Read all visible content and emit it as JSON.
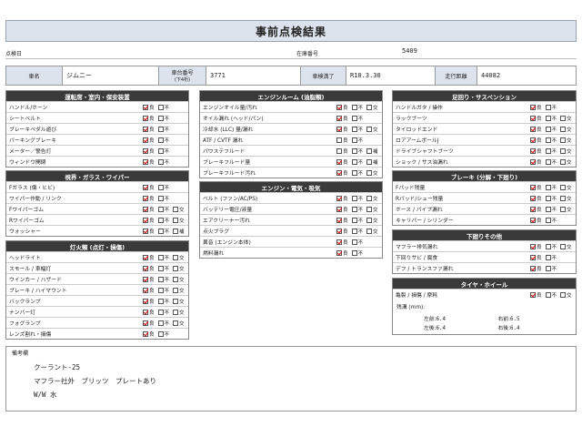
{
  "title": "事前点検結果",
  "header": {
    "check_date_label": "点検日",
    "stock_label": "在庫番号",
    "stock_no": "5409",
    "model_label": "車名",
    "model": "ジムニー",
    "chassis_label": "車台番号",
    "chassis_sub": "(下4桁)",
    "chassis": "3771",
    "inspection_label": "車検満了",
    "inspection": "R10.3.30",
    "mileage_label": "走行距離",
    "mileage": "44082"
  },
  "opt_labels": {
    "good": "良",
    "bad": "不",
    "exchange": "交",
    "fill": "補"
  },
  "sections": {
    "interior": {
      "title": "運転席・室内・保安装置",
      "items": [
        {
          "name": "ハンドル/ホーン",
          "opts": [
            "good",
            "bad"
          ],
          "checked": "good"
        },
        {
          "name": "シートベルト",
          "opts": [
            "good",
            "bad"
          ],
          "checked": "good"
        },
        {
          "name": "ブレーキペダル遊び",
          "opts": [
            "good",
            "bad"
          ],
          "checked": "good"
        },
        {
          "name": "パーキングブレーキ",
          "opts": [
            "good",
            "bad"
          ],
          "checked": "good"
        },
        {
          "name": "メーター／警告灯",
          "opts": [
            "good",
            "bad"
          ],
          "checked": "good"
        },
        {
          "name": "ウィンドウ開閉",
          "opts": [
            "good",
            "bad"
          ],
          "checked": "good"
        }
      ]
    },
    "visibility": {
      "title": "視界・ガラス・ワイパー",
      "items": [
        {
          "name": "Fガラス (傷・ヒビ)",
          "opts": [
            "good",
            "bad"
          ],
          "checked": "good"
        },
        {
          "name": "ワイパー作動 / リンク",
          "opts": [
            "good",
            "bad"
          ],
          "checked": "good"
        },
        {
          "name": "Fワイパーゴム",
          "opts": [
            "good",
            "bad",
            "exchange"
          ],
          "checked": "good"
        },
        {
          "name": "Rワイパーゴム",
          "opts": [
            "good",
            "bad",
            "exchange"
          ],
          "checked": "good"
        },
        {
          "name": "ウォッシャー",
          "opts": [
            "good",
            "bad",
            "fill"
          ],
          "checked": "good"
        }
      ]
    },
    "lights": {
      "title": "灯火類 (点灯・損傷)",
      "items": [
        {
          "name": "ヘッドライト",
          "opts": [
            "good",
            "bad",
            "exchange"
          ],
          "checked": "good"
        },
        {
          "name": "スモール / 車幅灯",
          "opts": [
            "good",
            "bad",
            "exchange"
          ],
          "checked": "good"
        },
        {
          "name": "ウインカー / ハザード",
          "opts": [
            "good",
            "bad",
            "exchange"
          ],
          "checked": "good"
        },
        {
          "name": "ブレーキ / ハイマウント",
          "opts": [
            "good",
            "bad",
            "exchange"
          ],
          "checked": "good"
        },
        {
          "name": "バックランプ",
          "opts": [
            "good",
            "bad",
            "exchange"
          ],
          "checked": "good"
        },
        {
          "name": "ナンバー灯",
          "opts": [
            "good",
            "bad",
            "exchange"
          ],
          "checked": "good"
        },
        {
          "name": "フォグランプ",
          "opts": [
            "good",
            "bad",
            "exchange"
          ],
          "checked": "good"
        },
        {
          "name": "レンズ割れ・損傷",
          "opts": [
            "good",
            "bad"
          ],
          "checked": "good"
        }
      ]
    },
    "engine": {
      "title": "エンジンルーム (油脂類)",
      "items": [
        {
          "name": "エンジンオイル量/汚れ",
          "opts": [
            "good",
            "bad",
            "exchange"
          ],
          "checked": "good"
        },
        {
          "name": "オイル漏れ (ヘッド/パン)",
          "opts": [
            "good",
            "bad"
          ],
          "checked": "good"
        },
        {
          "name": "冷却水 (LLC) 量/漏れ",
          "opts": [
            "good",
            "bad",
            "exchange"
          ],
          "checked": "good"
        },
        {
          "name": "ATF / CVTF 漏れ",
          "opts": [
            "good",
            "bad"
          ],
          "checked": ""
        },
        {
          "name": "パワステフルード",
          "opts": [
            "good",
            "bad",
            "fill"
          ],
          "checked": ""
        },
        {
          "name": "ブレーキフルード量",
          "opts": [
            "good",
            "bad",
            "fill"
          ],
          "checked": "good"
        },
        {
          "name": "ブレーキフルード汚れ",
          "opts": [
            "good",
            "bad",
            "exchange"
          ],
          "checked": "good"
        }
      ]
    },
    "electric": {
      "title": "エンジン・電気・吸気",
      "items": [
        {
          "name": "ベルト (ファン/AC/PS)",
          "opts": [
            "good",
            "bad",
            "exchange"
          ],
          "checked": "good"
        },
        {
          "name": "バッテリー電圧/液量",
          "opts": [
            "good",
            "bad",
            "exchange"
          ],
          "checked": "good"
        },
        {
          "name": "エアクリーナー汚れ",
          "opts": [
            "good",
            "bad",
            "exchange"
          ],
          "checked": "good"
        },
        {
          "name": "点火プラグ",
          "opts": [
            "good",
            "bad",
            "exchange"
          ],
          "checked": "good"
        },
        {
          "name": "異音 (エンジン本体)",
          "opts": [
            "good",
            "bad"
          ],
          "checked": "good"
        },
        {
          "name": "燃料漏れ",
          "opts": [
            "good",
            "bad"
          ],
          "checked": "good"
        }
      ]
    },
    "suspension": {
      "title": "足回り・サスペンション",
      "items": [
        {
          "name": "ハンドルガタ / 操作",
          "opts": [
            "good",
            "bad"
          ],
          "checked": "good"
        },
        {
          "name": "ラックブーツ",
          "opts": [
            "good",
            "bad",
            "exchange"
          ],
          "checked": "good"
        },
        {
          "name": "タイロッドエンド",
          "opts": [
            "good",
            "bad",
            "exchange"
          ],
          "checked": "good"
        },
        {
          "name": "ロアアームボールJ",
          "opts": [
            "good",
            "bad",
            "exchange"
          ],
          "checked": "good"
        },
        {
          "name": "ドライブシャフトブーツ",
          "opts": [
            "good",
            "bad",
            "exchange"
          ],
          "checked": "good"
        },
        {
          "name": "ショック / サス油漏れ",
          "opts": [
            "good",
            "bad",
            "exchange"
          ],
          "checked": "good"
        }
      ]
    },
    "brake": {
      "title": "ブレーキ (分解・下廻り)",
      "items": [
        {
          "name": "Fパッド残量",
          "opts": [
            "good",
            "bad",
            "exchange"
          ],
          "checked": "good"
        },
        {
          "name": "Rパッド/シュー残量",
          "opts": [
            "good",
            "bad",
            "exchange"
          ],
          "checked": "good"
        },
        {
          "name": "ホース / パイプ漏れ",
          "opts": [
            "good",
            "bad",
            "exchange"
          ],
          "checked": "good"
        },
        {
          "name": "キャリパー / シリンダー",
          "opts": [
            "good",
            "bad"
          ],
          "checked": "good"
        }
      ]
    },
    "under": {
      "title": "下廻りその他",
      "items": [
        {
          "name": "マフラー排気漏れ",
          "opts": [
            "good",
            "bad",
            "exchange"
          ],
          "checked": "good"
        },
        {
          "name": "下回りサビ / 腐食",
          "opts": [
            "good",
            "bad"
          ],
          "checked": "good"
        },
        {
          "name": "デフ / トランスファ漏れ",
          "opts": [
            "good",
            "bad"
          ],
          "checked": "good"
        }
      ]
    },
    "tire": {
      "title": "タイヤ・ホイール",
      "items": [
        {
          "name": "亀裂 / 損傷 / 摩耗",
          "opts": [
            "good",
            "bad",
            "exchange"
          ],
          "checked": "good"
        }
      ],
      "depth_label": "残溝 (mm):",
      "fl_label": "左前:",
      "fl": "6.4",
      "fr_label": "右前:",
      "fr": "6.5",
      "rl_label": "左後:",
      "rl": "6.4",
      "rr_label": "右後:",
      "rr": "6.4"
    }
  },
  "notes": {
    "label": "備考欄",
    "lines": [
      "クーラント-25",
      "マフラー社外　ブリッツ　プレートあり",
      "W/W 水"
    ]
  }
}
